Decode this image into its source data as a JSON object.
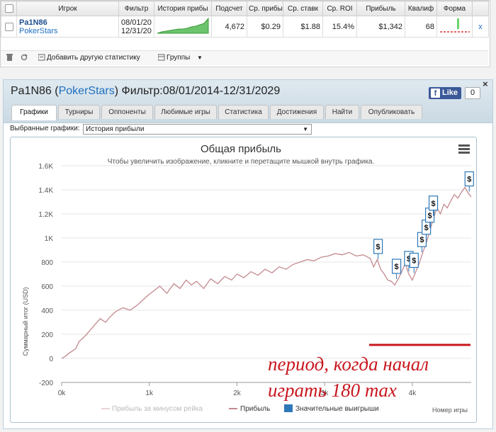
{
  "stats_table": {
    "headers": [
      "Игрок",
      "Фильтр",
      "История прибы",
      "Подсчет",
      "Ср. прибы",
      "Ср. ставк",
      "Ср. ROI",
      "Прибыль",
      "Квалиф",
      "Форма"
    ],
    "row": {
      "player": "Pa1N86",
      "site": "PokerStars",
      "filter_from": "08/01/20",
      "filter_to": "12/31/20",
      "count": "4,672",
      "avg_profit": "$0.29",
      "avg_stake": "$1.88",
      "avg_roi": "15.4%",
      "profit": "$1,342",
      "qualif": "68",
      "remove": "x"
    }
  },
  "toolbar": {
    "add_stats": "Добавить другую статистику",
    "groups": "Группы"
  },
  "panel": {
    "title_player": "Pa1N86",
    "title_site": "PokerStars",
    "title_filter": "Фильтр:08/01/2014-12/31/2029",
    "fb_like": "Like",
    "fb_count": "0",
    "close": "×",
    "tabs": [
      "Графики",
      "Турниры",
      "Оппоненты",
      "Любимые игры",
      "Статистика",
      "Достижения",
      "Найти",
      "Опубликовать"
    ],
    "selector_label": "Выбранные графики:",
    "selector_value": "История прибыли"
  },
  "annotation": {
    "line1": "период, когда начал",
    "line2": "играть 180 max",
    "color": "#c8171e"
  },
  "colors": {
    "profit_line": "#c38a8f",
    "rake_line": "#e8d3d5",
    "big_win_marker": "#2f78b7",
    "sparkline": "#3a9a3a"
  },
  "chart_data": {
    "type": "line",
    "title": "Общая прибыль",
    "subtitle": "Чтобы увеличить изображение, кликните и перетащите мышкой внутрь графика.",
    "xlabel": "Номер игры",
    "ylabel": "Суммарный итог (USD)",
    "xlim": [
      0,
      4672
    ],
    "ylim": [
      -200,
      1600
    ],
    "x_ticks": [
      "0k",
      "1k",
      "2k",
      "3k",
      "4k"
    ],
    "y_ticks": [
      "-200",
      "0",
      "200",
      "400",
      "600",
      "800",
      "1K",
      "1.2K",
      "1.4K",
      "1.6K"
    ],
    "grid": true,
    "legend": [
      "Прибыль за минусом рейка",
      "Прибыль",
      "Значительные выигрыши"
    ],
    "series": [
      {
        "name": "Прибыль",
        "x": [
          0,
          40,
          80,
          120,
          160,
          200,
          260,
          320,
          380,
          440,
          500,
          560,
          620,
          700,
          780,
          860,
          920,
          980,
          1050,
          1120,
          1200,
          1280,
          1350,
          1420,
          1480,
          1540,
          1620,
          1700,
          1780,
          1860,
          1940,
          2000,
          2080,
          2160,
          2240,
          2320,
          2400,
          2480,
          2560,
          2640,
          2720,
          2800,
          2880,
          2960,
          3040,
          3120,
          3200,
          3280,
          3360,
          3440,
          3520,
          3560,
          3600,
          3640,
          3680,
          3720,
          3760,
          3800,
          3840,
          3880,
          3920,
          3960,
          4000,
          4040,
          4080,
          4120,
          4160,
          4200,
          4240,
          4280,
          4320,
          4360,
          4400,
          4440,
          4480,
          4520,
          4560,
          4600,
          4640,
          4672
        ],
        "values": [
          0,
          15,
          40,
          60,
          80,
          140,
          180,
          230,
          280,
          330,
          300,
          350,
          390,
          420,
          400,
          440,
          480,
          520,
          560,
          600,
          540,
          620,
          580,
          650,
          610,
          640,
          580,
          660,
          620,
          680,
          650,
          700,
          670,
          720,
          690,
          740,
          710,
          760,
          740,
          780,
          800,
          820,
          810,
          840,
          850,
          870,
          860,
          880,
          850,
          860,
          830,
          760,
          820,
          740,
          700,
          650,
          640,
          610,
          660,
          720,
          790,
          700,
          650,
          720,
          790,
          880,
          960,
          1060,
          1160,
          1250,
          1200,
          1280,
          1250,
          1310,
          1360,
          1330,
          1380,
          1420,
          1370,
          1342
        ]
      }
    ],
    "big_wins_x": [
      3610,
      3820,
      3960,
      4020,
      4110,
      4160,
      4200,
      4240,
      4650
    ]
  },
  "icons": [
    "trash-icon",
    "refresh-icon",
    "add-stats-icon",
    "groups-icon",
    "dropdown-arrow-icon",
    "chart-menu-icon",
    "close-icon",
    "facebook-like-icon"
  ]
}
